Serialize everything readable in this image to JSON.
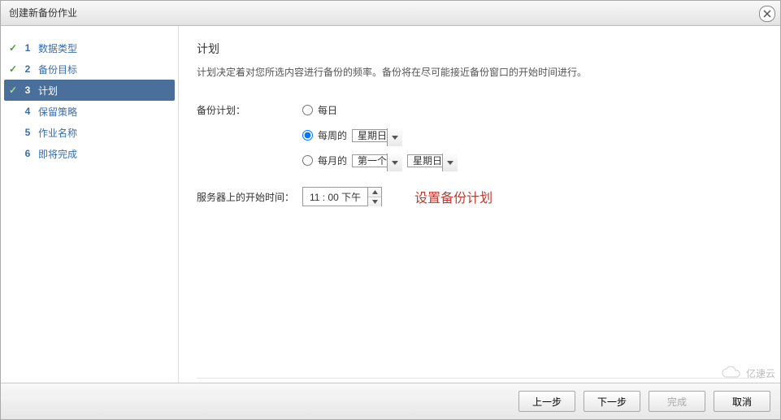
{
  "window": {
    "title": "创建新备份作业"
  },
  "sidebar": {
    "steps": [
      {
        "num": "1",
        "label": "数据类型",
        "state": "done"
      },
      {
        "num": "2",
        "label": "备份目标",
        "state": "done"
      },
      {
        "num": "3",
        "label": "计划",
        "state": "active"
      },
      {
        "num": "4",
        "label": "保留策略",
        "state": "pending"
      },
      {
        "num": "5",
        "label": "作业名称",
        "state": "pending"
      },
      {
        "num": "6",
        "label": "即将完成",
        "state": "pending"
      }
    ]
  },
  "content": {
    "heading": "计划",
    "description": "计划决定着对您所选内容进行备份的频率。备份将在尽可能接近备份窗口的开始时间进行。",
    "schedule_label": "备份计划：",
    "radio_daily": "每日",
    "radio_weekly": "每周的",
    "radio_monthly": "每月的",
    "weekly_day_selected": "星期日",
    "monthly_ordinal_selected": "第一个",
    "monthly_day_selected": "星期日",
    "start_time_label": "服务器上的开始时间：",
    "start_time_value": "11 : 00 下午",
    "annotation": "设置备份计划"
  },
  "footer": {
    "back": "上一步",
    "next": "下一步",
    "finish": "完成",
    "cancel": "取消"
  },
  "watermark": "亿速云"
}
